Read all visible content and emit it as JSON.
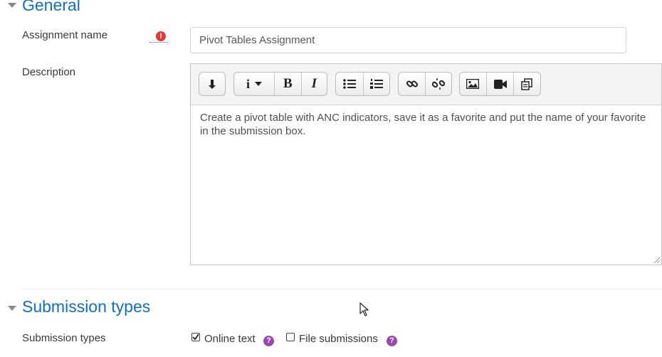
{
  "general": {
    "title": "General",
    "assignment_name_label": "Assignment name",
    "assignment_name_value": "Pivot Tables Assignment",
    "required_icon_glyph": "!",
    "description_label": "Description",
    "description_text": "Create a pivot table with ANC indicators, save it as a favorite and put the name of your favorite in the submission box."
  },
  "toolbar": {
    "icons": [
      "toggle-toolbar-icon",
      "info-paragraph-icon",
      "bold-icon",
      "italic-icon",
      "bullet-list-icon",
      "numbered-list-icon",
      "link-icon",
      "unlink-icon",
      "image-icon",
      "video-icon",
      "manage-files-icon"
    ],
    "bold_glyph": "B",
    "italic_glyph": "I",
    "info_glyph": "i"
  },
  "submission": {
    "title": "Submission types",
    "types_label": "Submission types",
    "options": [
      {
        "label": "Online text",
        "checked": true
      },
      {
        "label": "File submissions",
        "checked": false
      }
    ],
    "help_glyph": "?"
  },
  "colors": {
    "accent": "#0f6fc5",
    "required": "#e53935",
    "help": "#9c44b3"
  }
}
